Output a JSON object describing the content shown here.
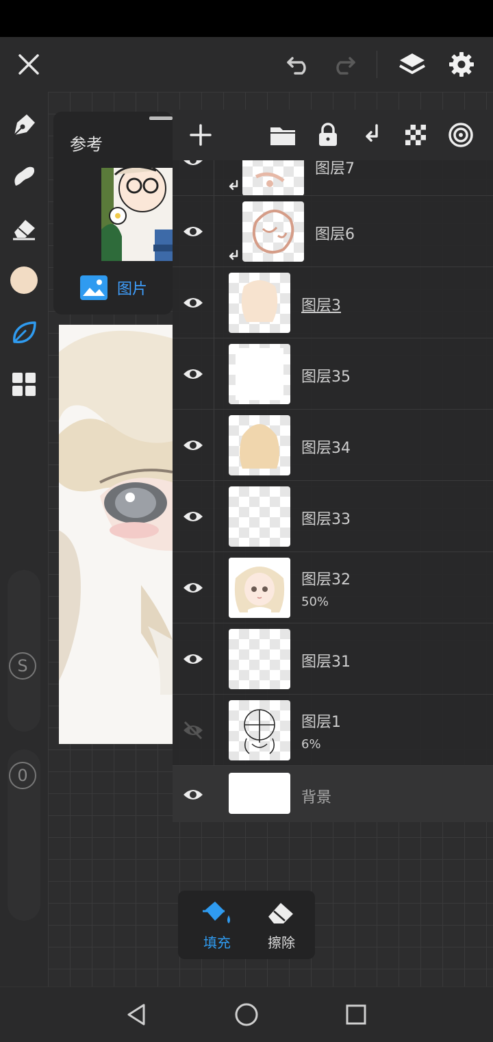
{
  "top_bar": {
    "close_icon": "close-icon",
    "undo_icon": "undo-icon",
    "redo_icon": "redo-icon",
    "layers_icon": "layers-icon",
    "settings_icon": "gear-icon"
  },
  "left_toolbar": {
    "tools": [
      "pen-icon",
      "smudge-icon",
      "eraser-icon",
      "color-swatch",
      "leaf-brush-icon",
      "grid-icon"
    ],
    "active_color": "#f2dcc4",
    "accent": "#2f9bf0",
    "size_slider_label": "S",
    "opacity_slider_label": "0"
  },
  "reference": {
    "title": "参考",
    "image_label": "图片"
  },
  "layers": [
    {
      "name": "图层7",
      "opacity": ""
    },
    {
      "name": "图层6",
      "opacity": ""
    },
    {
      "name": "图层3",
      "opacity": ""
    },
    {
      "name": "图层35",
      "opacity": ""
    },
    {
      "name": "图层34",
      "opacity": ""
    },
    {
      "name": "图层33",
      "opacity": ""
    },
    {
      "name": "图层32",
      "opacity": "50%"
    },
    {
      "name": "图层31",
      "opacity": ""
    },
    {
      "name": "图层1",
      "opacity": "6%"
    },
    {
      "name": "背景",
      "opacity": ""
    }
  ],
  "fill_popup": {
    "fill_label": "填充",
    "erase_label": "擦除"
  }
}
